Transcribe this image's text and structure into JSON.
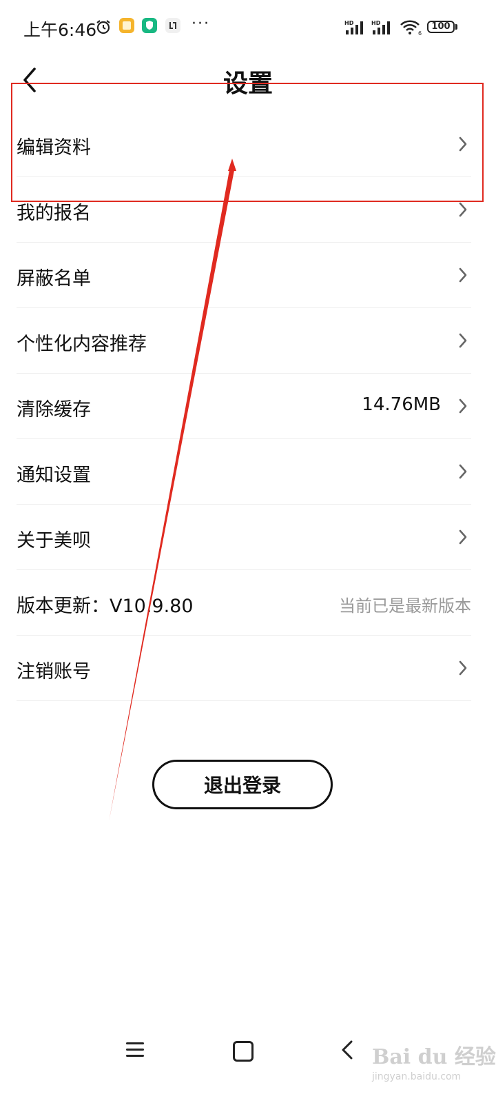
{
  "status_bar": {
    "time": "上午6:46",
    "icons": [
      "alarm-icon",
      "notes-app-icon",
      "security-app-icon",
      "sync-app-icon",
      "more-dots-icon",
      "hd-signal-icon",
      "hd-signal-icon",
      "wifi-icon",
      "battery-icon"
    ],
    "more": "···",
    "signal_label": "HD",
    "wifi_label": "6",
    "battery": "100"
  },
  "header": {
    "title": "设置",
    "back_icon": "chevron-left-icon"
  },
  "settings": {
    "items": [
      {
        "label": "编辑资料"
      },
      {
        "label": "我的报名"
      },
      {
        "label": "屏蔽名单"
      },
      {
        "label": "个性化内容推荐"
      },
      {
        "label": "清除缓存",
        "value": "14.76MB"
      },
      {
        "label": "通知设置"
      },
      {
        "label": "关于美呗"
      },
      {
        "label": "版本更新：V10.9.80",
        "note": "当前已是最新版本"
      },
      {
        "label": "注销账号"
      }
    ]
  },
  "logout": {
    "label": "退出登录"
  },
  "colors": {
    "annotation": "#e02a20",
    "text": "#111111",
    "note": "#999999",
    "divider": "#eeeeee"
  },
  "watermark": {
    "main": "Bai du 经验",
    "sub": "jingyan.baidu.com"
  }
}
